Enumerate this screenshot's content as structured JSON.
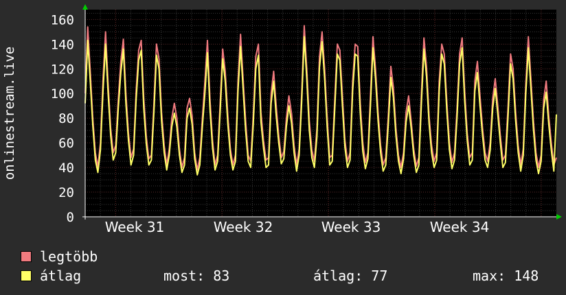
{
  "chart_data": {
    "type": "line",
    "ylabel": "onlinestream.live",
    "ylim": [
      0,
      168
    ],
    "yticks": [
      0,
      20,
      40,
      60,
      80,
      100,
      120,
      140,
      160
    ],
    "xticks": [
      "Week 31",
      "Week 32",
      "Week 33",
      "Week 34"
    ],
    "grid": true,
    "background": "#000000",
    "series": [
      {
        "name": "legtöbb",
        "color": "#f07a7f",
        "values": [
          100,
          154,
          118,
          80,
          52,
          40,
          60,
          112,
          150,
          108,
          72,
          52,
          58,
          95,
          126,
          144,
          100,
          68,
          48,
          55,
          102,
          135,
          143,
          96,
          65,
          47,
          50,
          92,
          140,
          128,
          85,
          58,
          42,
          55,
          80,
          92,
          80,
          55,
          40,
          48,
          88,
          96,
          82,
          52,
          38,
          48,
          80,
          110,
          143,
          95,
          62,
          42,
          50,
          92,
          136,
          118,
          82,
          55,
          42,
          50,
          110,
          148,
          112,
          78,
          50,
          45,
          82,
          130,
          140,
          85,
          62,
          46,
          48,
          100,
          118,
          90,
          66,
          48,
          53,
          80,
          98,
          84,
          58,
          42,
          55,
          100,
          155,
          120,
          78,
          54,
          45,
          72,
          130,
          150,
          120,
          80,
          48,
          50,
          96,
          140,
          135,
          98,
          62,
          45,
          52,
          110,
          140,
          138,
          92,
          60,
          44,
          52,
          98,
          146,
          120,
          85,
          58,
          42,
          48,
          82,
          122,
          105,
          72,
          50,
          40,
          52,
          85,
          98,
          78,
          55,
          41,
          48,
          100,
          145,
          122,
          82,
          58,
          45,
          52,
          110,
          140,
          132,
          92,
          60,
          44,
          52,
          88,
          132,
          145,
          102,
          68,
          48,
          52,
          110,
          126,
          98,
          72,
          52,
          45,
          60,
          96,
          112,
          90,
          66,
          46,
          50,
          88,
          132,
          120,
          85,
          58,
          42,
          55,
          108,
          146,
          112,
          78,
          52,
          40,
          50,
          95,
          110,
          82,
          60,
          42,
          48
        ]
      },
      {
        "name": "átlag",
        "color": "#ffff66",
        "values": [
          92,
          143,
          110,
          74,
          46,
          36,
          54,
          102,
          140,
          100,
          66,
          46,
          52,
          88,
          117,
          136,
          92,
          62,
          42,
          50,
          95,
          127,
          135,
          88,
          59,
          42,
          46,
          85,
          131,
          120,
          78,
          52,
          38,
          50,
          73,
          84,
          73,
          50,
          36,
          42,
          80,
          88,
          75,
          47,
          34,
          42,
          73,
          100,
          133,
          87,
          56,
          38,
          45,
          85,
          128,
          110,
          75,
          50,
          38,
          45,
          102,
          138,
          104,
          70,
          45,
          40,
          75,
          120,
          131,
          77,
          56,
          40,
          42,
          92,
          110,
          82,
          60,
          43,
          47,
          73,
          90,
          76,
          52,
          37,
          50,
          93,
          146,
          112,
          70,
          48,
          40,
          65,
          121,
          142,
          112,
          73,
          42,
          45,
          88,
          132,
          127,
          90,
          56,
          40,
          46,
          102,
          132,
          130,
          84,
          53,
          39,
          47,
          90,
          137,
          112,
          78,
          52,
          37,
          42,
          75,
          113,
          97,
          66,
          45,
          35,
          47,
          77,
          90,
          72,
          50,
          36,
          42,
          92,
          136,
          114,
          76,
          52,
          40,
          46,
          102,
          132,
          124,
          85,
          54,
          39,
          46,
          81,
          124,
          137,
          94,
          62,
          42,
          46,
          102,
          117,
          90,
          66,
          46,
          40,
          54,
          88,
          104,
          83,
          60,
          40,
          44,
          80,
          124,
          112,
          78,
          52,
          37,
          50,
          100,
          137,
          104,
          71,
          46,
          35,
          45,
          88,
          101,
          75,
          54,
          37,
          83
        ]
      }
    ]
  },
  "legend": {
    "items": [
      {
        "label": "legtöbb",
        "color": "#f07a7f"
      },
      {
        "label": "átlag",
        "color": "#ffff66"
      }
    ],
    "stats": {
      "now": "most: 83",
      "avg": "átlag: 77",
      "max": "max: 148"
    }
  }
}
